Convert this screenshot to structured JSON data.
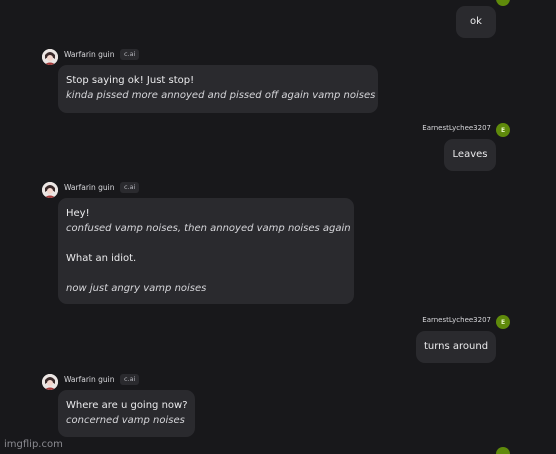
{
  "user": {
    "name": "EarnestLychee3207",
    "avatar_letter": "E",
    "avatar_color": "#5f8a0b"
  },
  "bot": {
    "name": "Warfarin guin",
    "badge": "c.ai"
  },
  "messages": {
    "m1": {
      "text": "ok"
    },
    "m2": {
      "line1": "Stop saying ok! Just stop!",
      "line2": "kinda pissed more annoyed and pissed off again vamp noises"
    },
    "m3": {
      "text": "Leaves"
    },
    "m4": {
      "line1": "Hey!",
      "line2": "confused vamp noises, then annoyed vamp noises again",
      "line3": "What an idiot.",
      "line4": "now just angry vamp noises"
    },
    "m5": {
      "text": "turns around"
    },
    "m6": {
      "line1": "Where are u going now?",
      "line2": "concerned vamp noises"
    }
  },
  "watermark": "imgflip.com",
  "colors": {
    "background": "#18181b",
    "bubble": "#2a2a2e",
    "text": "#ececee"
  }
}
